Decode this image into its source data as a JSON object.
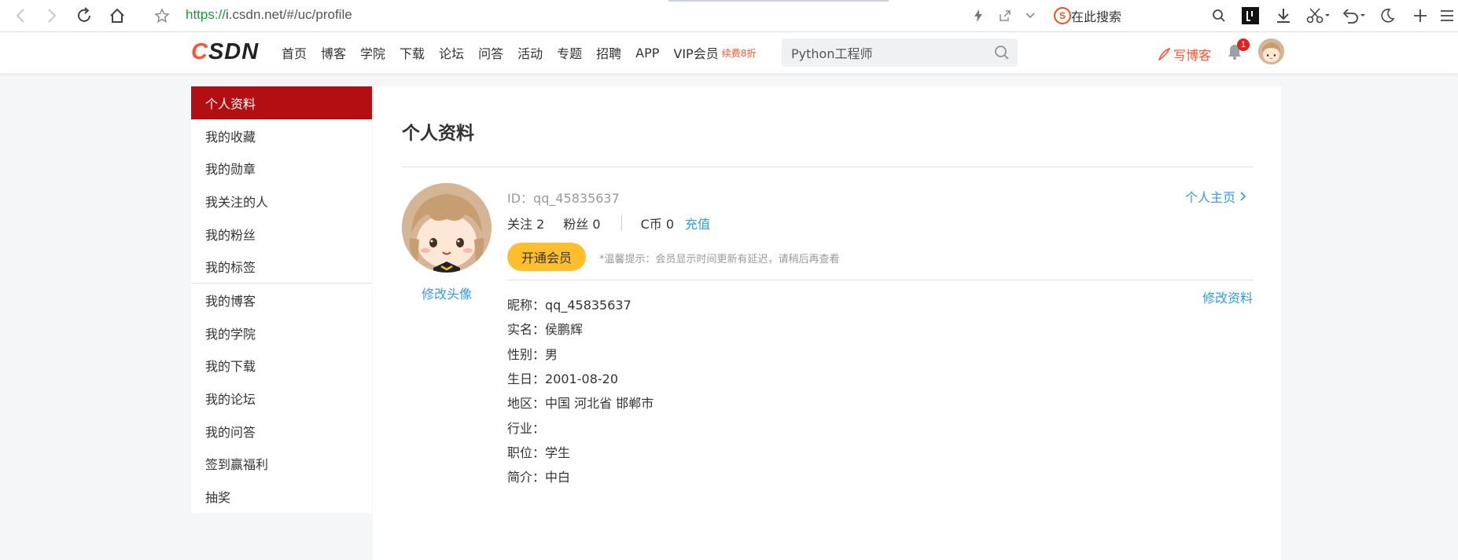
{
  "browser": {
    "url_proto": "https://",
    "url_rest": "i.csdn.net/#/uc/profile",
    "search_placeholder": "在此搜索"
  },
  "header": {
    "logo": "CSDN",
    "nav": [
      "首页",
      "博客",
      "学院",
      "下载",
      "论坛",
      "问答",
      "活动",
      "专题",
      "招聘",
      "APP",
      "VIP会员"
    ],
    "vip_badge": "续费8折",
    "search_value": "Python工程师",
    "write_label": "写博客",
    "notification_count": "1"
  },
  "sidebar": {
    "items": [
      "个人资料",
      "我的收藏",
      "我的勋章",
      "我关注的人",
      "我的粉丝",
      "我的标签",
      "我的博客",
      "我的学院",
      "我的下载",
      "我的论坛",
      "我的问答",
      "签到赢福利",
      "抽奖"
    ],
    "active_index": 0
  },
  "profile": {
    "title": "个人资料",
    "change_avatar": "修改头像",
    "id": "ID：qq_45835637",
    "follow_label": "关注 2",
    "fans_label": "粉丝 0",
    "coin_label": "C币 0",
    "recharge": "充值",
    "home_link": "个人主页",
    "vip_button": "开通会员",
    "tip": "*温馨提示：会员显示时间更新有延迟，请稍后再查看",
    "edit_link": "修改资料",
    "fields": [
      {
        "label": "昵称：",
        "value": "qq_45835637"
      },
      {
        "label": "实名：",
        "value": "侯鹏辉"
      },
      {
        "label": "性别：",
        "value": "男"
      },
      {
        "label": "生日：",
        "value": "2001-08-20"
      },
      {
        "label": "地区：",
        "value": "中国 河北省 邯郸市"
      },
      {
        "label": "行业：",
        "value": ""
      },
      {
        "label": "职位：",
        "value": "学生"
      },
      {
        "label": "简介：",
        "value": "中白"
      }
    ]
  },
  "colors": {
    "brand": "#fc5531",
    "active_sidebar": "#b30f13",
    "link": "#3399ea",
    "vip_button": "#ffbf2d"
  }
}
